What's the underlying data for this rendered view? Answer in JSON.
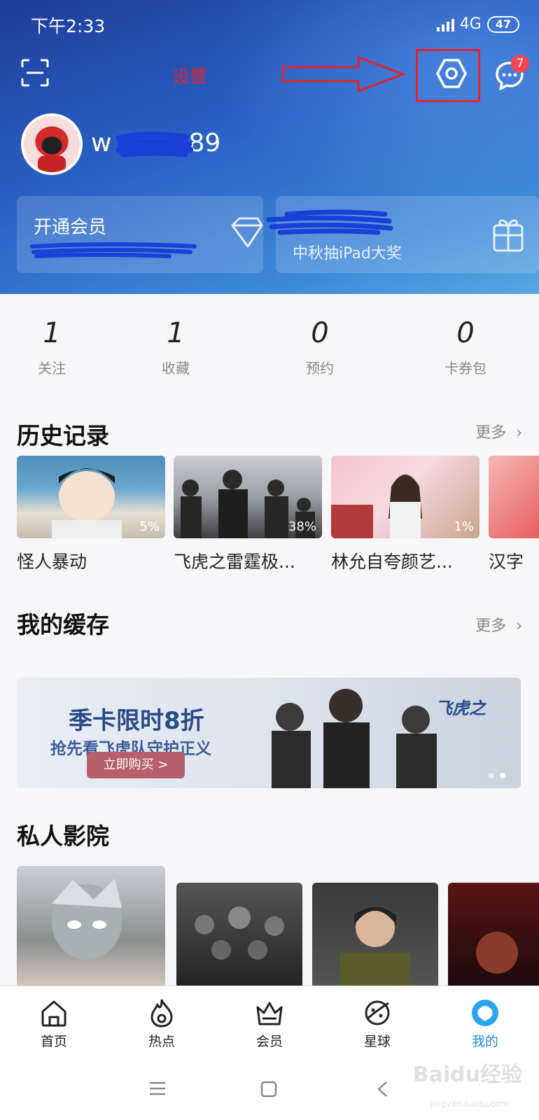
{
  "status_bar": {
    "time": "下午2:33",
    "network": "4G",
    "battery": "47"
  },
  "header": {
    "annotation_label": "设置",
    "message_badge": "7",
    "username_prefix": "w",
    "username_suffix": "89",
    "vip_card": {
      "title": "开通会员"
    },
    "prize_card": {
      "subtitle": "中秋抽iPad大奖"
    }
  },
  "stats": [
    {
      "value": "1",
      "label": "关注"
    },
    {
      "value": "1",
      "label": "收藏"
    },
    {
      "value": "0",
      "label": "预约"
    },
    {
      "value": "0",
      "label": "卡券包"
    }
  ],
  "history": {
    "title": "历史记录",
    "more": "更多",
    "items": [
      {
        "title": "怪人暴动",
        "progress": "5%"
      },
      {
        "title": "飞虎之雷霆极...",
        "progress": "38%"
      },
      {
        "title": "林允自夸颜艺...",
        "progress": "1%"
      },
      {
        "title": "汉字"
      }
    ]
  },
  "cache": {
    "title": "我的缓存",
    "more": "更多",
    "banner": {
      "headline": "季卡限时8折",
      "subline": "抢先看飞虎队守护正义",
      "button": "立即购买 >",
      "logo": "飞虎之"
    }
  },
  "cinema": {
    "title": "私人影院"
  },
  "bottom_nav": [
    {
      "label": "首页",
      "icon": "home-icon"
    },
    {
      "label": "热点",
      "icon": "flame-icon"
    },
    {
      "label": "会员",
      "icon": "crown-icon"
    },
    {
      "label": "星球",
      "icon": "planet-icon"
    },
    {
      "label": "我的",
      "icon": "profile-icon",
      "active": true
    }
  ],
  "watermark": {
    "brand": "Baidu经验",
    "url": "jingyan.baidu.com"
  },
  "colors": {
    "accent": "#1e88e5",
    "annotation": "#e3242b",
    "header_top": "#1e3d9c",
    "badge": "#f34553"
  }
}
